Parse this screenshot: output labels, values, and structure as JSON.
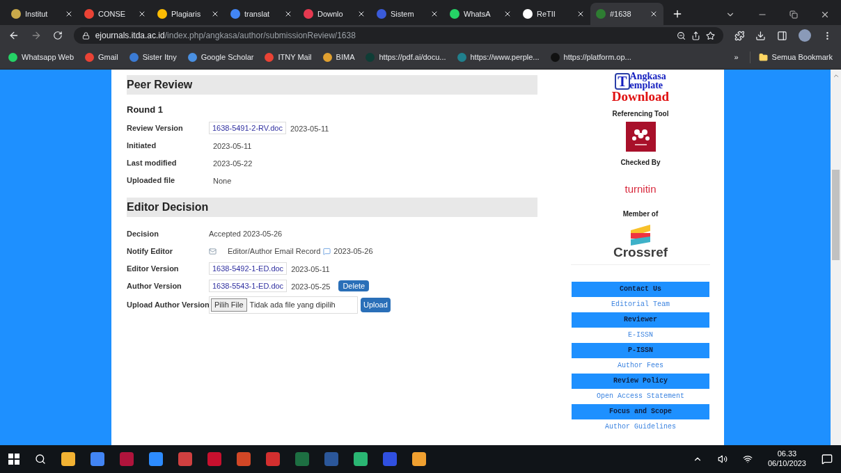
{
  "tabs": [
    {
      "label": "Institut",
      "selected": false
    },
    {
      "label": "CONSE",
      "selected": false
    },
    {
      "label": "Plagiaris",
      "selected": false
    },
    {
      "label": "translat",
      "selected": false
    },
    {
      "label": "Downlo",
      "selected": false
    },
    {
      "label": "Sistem",
      "selected": false
    },
    {
      "label": "WhatsA",
      "selected": false
    },
    {
      "label": "ReTII",
      "selected": false
    },
    {
      "label": "#1638",
      "selected": true
    }
  ],
  "address": {
    "host": "ejournals.itda.ac.id",
    "path": "/index.php/angkasa/author/submissionReview/1638"
  },
  "bookmarks": [
    {
      "label": "Whatsapp Web"
    },
    {
      "label": "Gmail"
    },
    {
      "label": "Sister Itny"
    },
    {
      "label": "Google Scholar"
    },
    {
      "label": "ITNY Mail"
    },
    {
      "label": "BIMA"
    },
    {
      "label": "https://pdf.ai/docu..."
    },
    {
      "label": "https://www.perple..."
    },
    {
      "label": "https://platform.op..."
    }
  ],
  "bookmarks_overflow": "»",
  "all_bookmarks": "Semua Bookmark",
  "peer_review": {
    "heading": "Peer Review",
    "round": "Round 1",
    "rows": [
      {
        "label": "Review Version",
        "file": "1638-5491-2-RV.doc",
        "value": "2023-05-11"
      },
      {
        "label": "Initiated",
        "value": "2023-05-11"
      },
      {
        "label": "Last modified",
        "value": "2023-05-22"
      },
      {
        "label": "Uploaded file",
        "value": "None"
      }
    ]
  },
  "editor_decision": {
    "heading": "Editor Decision",
    "decision": {
      "label": "Decision",
      "value": "Accepted 2023-05-26"
    },
    "notify": {
      "label": "Notify Editor",
      "link": "Editor/Author Email Record",
      "date": "2023-05-26"
    },
    "editor_version": {
      "label": "Editor Version",
      "file": "1638-5492-1-ED.doc",
      "date": "2023-05-11"
    },
    "author_version": {
      "label": "Author Version",
      "file": "1638-5543-1-ED.doc",
      "date": "2023-05-25",
      "button": "Delete"
    },
    "upload": {
      "label": "Upload Author Version",
      "choose": "Pilih File",
      "status": "Tidak ada file yang dipilih",
      "button": "Upload"
    }
  },
  "sidebar": {
    "template": {
      "letter": "T",
      "top": "Angkasa",
      "bottom": "emplate",
      "download": "Download"
    },
    "referencing": "Referencing Tool",
    "checked_by": "Checked By",
    "turnitin": "turnitin",
    "member_of": "Member of",
    "crossref": "Crossref",
    "links": [
      {
        "label": "Contact Us",
        "kind": "bar"
      },
      {
        "label": "Editorial Team",
        "kind": "link"
      },
      {
        "label": "Reviewer",
        "kind": "bar"
      },
      {
        "label": "E-ISSN",
        "kind": "link"
      },
      {
        "label": "P-ISSN",
        "kind": "bar"
      },
      {
        "label": "Author Fees",
        "kind": "link"
      },
      {
        "label": "Review Policy",
        "kind": "bar"
      },
      {
        "label": "Open Access Statement",
        "kind": "link"
      },
      {
        "label": "Focus and Scope",
        "kind": "bar"
      },
      {
        "label": "Author Guidelines",
        "kind": "link"
      }
    ]
  },
  "taskbar": {
    "time": "06.33",
    "date": "06/10/2023"
  }
}
